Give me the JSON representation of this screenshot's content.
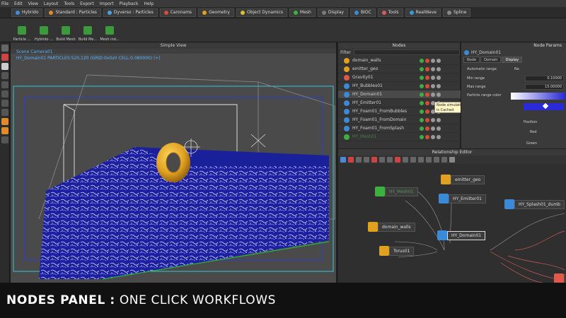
{
  "menubar": [
    "File",
    "Edit",
    "View",
    "Layout",
    "Tools",
    "Export",
    "Import",
    "Playback",
    "Help"
  ],
  "shelf_tabs": [
    {
      "label": "Hybrido",
      "color": "#3c8fd8"
    },
    {
      "label": "Standard : Particles",
      "color": "#e08a2a"
    },
    {
      "label": "Dyverso : Particles",
      "color": "#4aa0d8"
    },
    {
      "label": "Caronams",
      "color": "#d84a3a"
    },
    {
      "label": "Geometry",
      "color": "#e0a020"
    },
    {
      "label": "Object Dynamics",
      "color": "#d8c030"
    },
    {
      "label": "Mesh",
      "color": "#3cb040"
    },
    {
      "label": "Display",
      "color": "#7a7a7a"
    },
    {
      "label": "BIOC",
      "color": "#3a8ad8"
    },
    {
      "label": "Tools",
      "color": "#d85a5a"
    },
    {
      "label": "RealWave",
      "color": "#3a9ad8"
    },
    {
      "label": "Spline",
      "color": "#888888"
    }
  ],
  "shelf_tools": [
    {
      "label": "Particle ...",
      "color": "#3c9a3c"
    },
    {
      "label": "Hybrido ...",
      "color": "#3c9a3c"
    },
    {
      "label": "Build Mesh",
      "color": "#3c9a3c"
    },
    {
      "label": "Build Me...",
      "color": "#3c9a3c"
    },
    {
      "label": "Mesh ind...",
      "color": "#3c9a3c"
    }
  ],
  "viewport": {
    "title": "Simple View",
    "camera_label": "Scene Camera01",
    "info_line": "HY_Domain01 PARTICLES:520,120 (GRID:0x0x0 CELL:0.080000) (+)"
  },
  "nodes_panel": {
    "title": "Nodes",
    "filter_label": "Filter",
    "nodes": [
      {
        "label": "domain_walls",
        "icon_color": "#e0a020",
        "selected": false,
        "dim": false
      },
      {
        "label": "emitter_geo",
        "icon_color": "#e0a020",
        "selected": false,
        "dim": false
      },
      {
        "label": "Gravity01",
        "icon_color": "#e05a4a",
        "selected": false,
        "dim": false
      },
      {
        "label": "HY_Bubbles01",
        "icon_color": "#3a8ad8",
        "selected": false,
        "dim": false
      },
      {
        "label": "HY_Domain01",
        "icon_color": "#3a8ad8",
        "selected": true,
        "dim": false
      },
      {
        "label": "HY_Emitter01",
        "icon_color": "#3a8ad8",
        "selected": false,
        "dim": false
      },
      {
        "label": "HY_Foam01_FromBubbles",
        "icon_color": "#3a8ad8",
        "selected": false,
        "dim": false
      },
      {
        "label": "HY_Foam01_FromDomain",
        "icon_color": "#3a8ad8",
        "selected": false,
        "dim": false
      },
      {
        "label": "HY_Foam01_FromSplash",
        "icon_color": "#3a8ad8",
        "selected": false,
        "dim": false
      },
      {
        "label": "HY_Mesh01",
        "icon_color": "#3cb040",
        "selected": false,
        "dim": true
      }
    ],
    "tooltip": "Node simulation is Cached"
  },
  "node_params": {
    "title": "Node Params",
    "node_name": "HY_Domain01",
    "tabs": [
      "Node",
      "Domain",
      "Display"
    ],
    "active_tab": "Display",
    "automatic_range_label": "Automatic range",
    "automatic_range_value": "No",
    "min_range_label": "Min range",
    "min_range_value": "0.10000",
    "max_range_label": "Max range",
    "max_range_value": "15.00000",
    "particle_color_label": "Particle range color",
    "position_label": "Position",
    "red_label": "Red",
    "green_label": "Green",
    "gradient_color": "#2a2ad8"
  },
  "relationship_editor": {
    "title": "Relationship Editor",
    "graph_nodes": [
      {
        "label": "emitter_geo",
        "icon_color": "#e0a020",
        "selected": false,
        "dim": false
      },
      {
        "label": "HY_Mesh01",
        "icon_color": "#3cb040",
        "selected": false,
        "dim": true
      },
      {
        "label": "HY_Emitter01",
        "icon_color": "#3a8ad8",
        "selected": false,
        "dim": false
      },
      {
        "label": "HY_Splash01_dumb",
        "icon_color": "#3a8ad8",
        "selected": false,
        "dim": false
      },
      {
        "label": "domain_walls",
        "icon_color": "#e0a020",
        "selected": false,
        "dim": false
      },
      {
        "label": "HY_Domain01",
        "icon_color": "#3a8ad8",
        "selected": true,
        "dim": false
      },
      {
        "label": "Torus01",
        "icon_color": "#e0a020",
        "selected": false,
        "dim": false
      },
      {
        "label": "Gra",
        "icon_color": "#e05a4a",
        "selected": false,
        "dim": false
      }
    ]
  },
  "caption": {
    "bold": "NODES PANEL :",
    "rest": " ONE CLICK WORKFLOWS"
  }
}
